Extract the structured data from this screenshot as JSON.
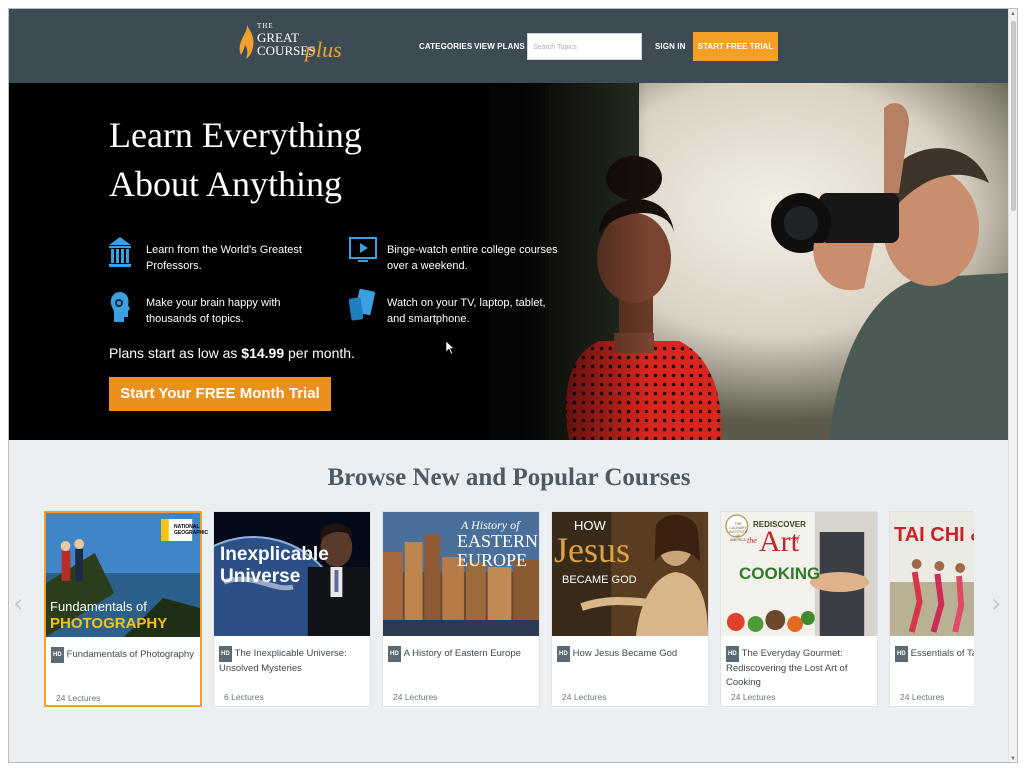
{
  "header": {
    "logo": {
      "the": "THE",
      "great": "GREAT",
      "courses": "COURSES",
      "plus": "plus"
    },
    "nav": {
      "categories": "CATEGORIES",
      "view_plans": "VIEW PLANS",
      "sign_in": "SIGN IN"
    },
    "search": {
      "placeholder": "Search Topics"
    },
    "trial_button": "START FREE TRIAL",
    "brand_color": "#f4a026",
    "bg_color": "#3d4b55"
  },
  "hero": {
    "title_line1": "Learn Everything",
    "title_line2": "About Anything",
    "features": [
      {
        "icon": "building-columns-icon",
        "text": "Learn from the World's Greatest Professors."
      },
      {
        "icon": "tv-play-icon",
        "text": "Binge-watch entire college courses over a weekend."
      },
      {
        "icon": "brain-head-icon",
        "text": "Make your brain happy with thousands of topics."
      },
      {
        "icon": "devices-icon",
        "text": "Watch on your TV, laptop, tablet, and smartphone."
      }
    ],
    "plans_prefix": "Plans start as low as",
    "plans_price": "$14.99",
    "plans_suffix": "per month.",
    "cta": "Start Your FREE Month Trial"
  },
  "browse": {
    "title": "Browse New and Popular Courses",
    "courses": [
      {
        "thumb_text_small": "Fundamentals of",
        "thumb_text_big": "PHOTOGRAPHY",
        "badge": "NATIONAL GEOGRAPHIC",
        "hd": "HD",
        "title": "Fundamentals of Photography",
        "lectures": "24 Lectures"
      },
      {
        "thumb_text_small": "Inexplicable",
        "thumb_text_big": "Universe",
        "hd": "HD",
        "title": "The Inexplicable Universe: Unsolved Mysteries",
        "lectures": "6 Lectures"
      },
      {
        "thumb_text_small": "A History of",
        "thumb_text_big": "EASTERN EUROPE",
        "hd": "HD",
        "title": "A History of Eastern Europe",
        "lectures": "24 Lectures"
      },
      {
        "thumb_text_small": "HOW",
        "thumb_text_big": "Jesus",
        "thumb_text_sub": "BECAME GOD",
        "hd": "HD",
        "title": "How Jesus Became God",
        "lectures": "24 Lectures"
      },
      {
        "thumb_text_small": "REDISCOVER",
        "thumb_text_the": "the",
        "thumb_text_big": "Art",
        "thumb_text_of": "of",
        "thumb_text_sub": "COOKING",
        "badge": "THE CULINARY INSTITUTE OF AMERICA",
        "hd": "HD",
        "title": "The Everyday Gourmet: Rediscovering the Lost Art of Cooking",
        "lectures": "24 Lectures"
      },
      {
        "thumb_text_big": "TAI CHI & Q",
        "hd": "HD",
        "title": "Essentials of Tai Chi",
        "lectures": "24 Lectures"
      }
    ]
  }
}
